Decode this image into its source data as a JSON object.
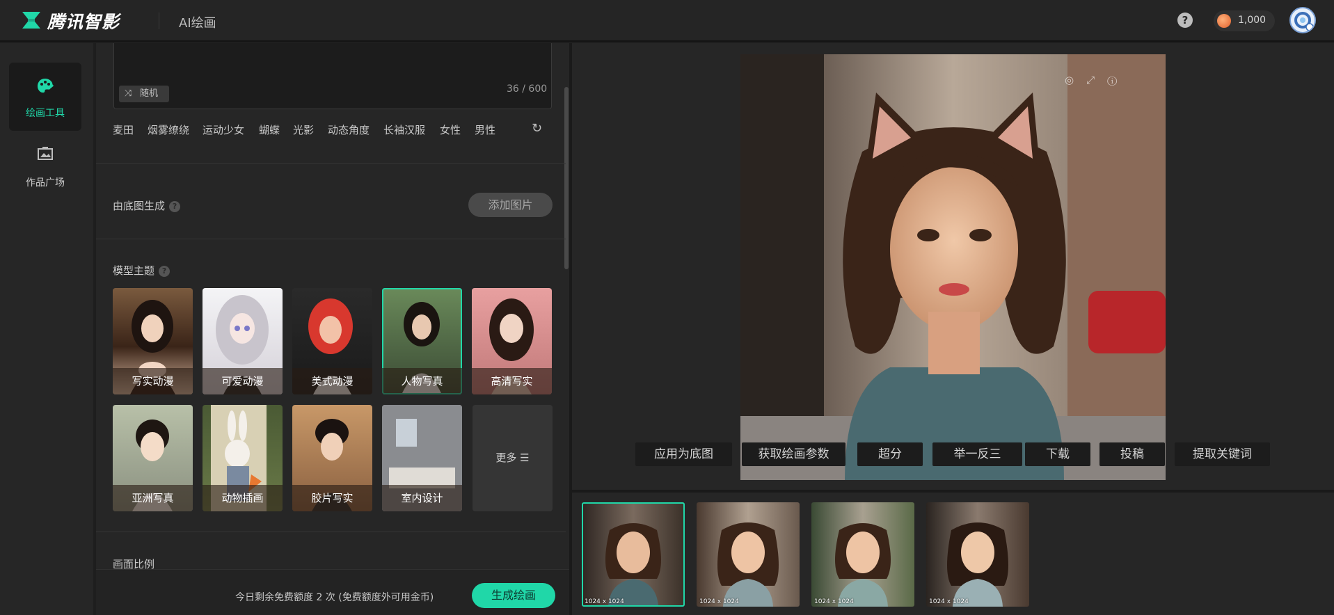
{
  "header": {
    "brand": "腾讯智影",
    "app_name": "AI绘画",
    "help": "?",
    "coins": "1,000"
  },
  "rail": {
    "items": [
      {
        "label": "绘画工具",
        "icon": "palette-icon",
        "active": true
      },
      {
        "label": "作品广场",
        "icon": "gallery-icon",
        "active": false
      }
    ]
  },
  "prompt": {
    "random_label": "随机",
    "counter": "36 / 600"
  },
  "tags": [
    "麦田",
    "烟雾缭绕",
    "运动少女",
    "蝴蝶",
    "光影",
    "动态角度",
    "长袖汉服",
    "女性",
    "男性"
  ],
  "base_image": {
    "label": "由底图生成",
    "add_button": "添加图片"
  },
  "models": {
    "label": "模型主题",
    "items": [
      {
        "label": "写实动漫"
      },
      {
        "label": "可爱动漫"
      },
      {
        "label": "美式动漫"
      },
      {
        "label": "人物写真",
        "selected": true
      },
      {
        "label": "高清写实"
      },
      {
        "label": "亚洲写真"
      },
      {
        "label": "动物插画"
      },
      {
        "label": "胶片写实"
      },
      {
        "label": "室内设计"
      }
    ],
    "more": "更多 ☰"
  },
  "ratio": {
    "label": "画面比例"
  },
  "footer": {
    "quota": "今日剩余免费额度 2 次 (免费额度外可用金币)",
    "generate": "生成绘画"
  },
  "actions": [
    "应用为底图",
    "获取绘画参数",
    "超分",
    "举一反三",
    "下载",
    "投稿",
    "提取关键词"
  ],
  "thumbnails": [
    {
      "size": "1024 x 1024",
      "selected": true
    },
    {
      "size": "1024 x 1024",
      "selected": false
    },
    {
      "size": "1024 x 1024",
      "selected": false
    },
    {
      "size": "1024 x 1024",
      "selected": false
    }
  ],
  "colors": {
    "accent": "#20d7a8",
    "bg": "#1e1e1e",
    "panel": "#262626"
  }
}
